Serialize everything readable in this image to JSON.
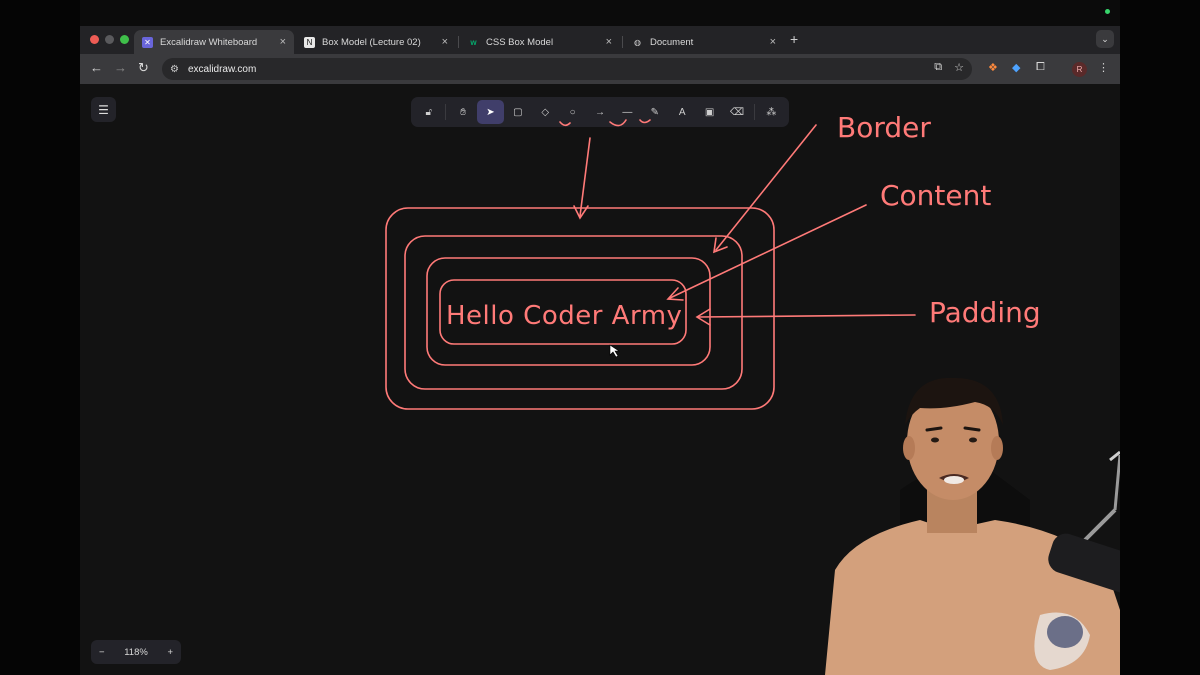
{
  "browser": {
    "tabs": [
      {
        "label": "Excalidraw Whiteboard",
        "active": true,
        "icon": "excalidraw-icon"
      },
      {
        "label": "Box Model (Lecture 02)",
        "active": false,
        "icon": "notion-icon"
      },
      {
        "label": "CSS Box Model",
        "active": false,
        "icon": "w3schools-icon"
      },
      {
        "label": "Document",
        "active": false,
        "icon": "globe-icon"
      }
    ],
    "url": "excalidraw.com",
    "profile_initial": "R"
  },
  "excalidraw": {
    "tools": [
      "lock",
      "hand",
      "selection",
      "rectangle",
      "diamond",
      "ellipse",
      "arrow",
      "line",
      "draw",
      "text",
      "image",
      "eraser",
      "more-tools"
    ],
    "active_tool": "selection",
    "zoom": "118%",
    "zoom_out": "−",
    "zoom_in": "+"
  },
  "drawing": {
    "inner_text": "Hello Coder Army",
    "labels": {
      "border": "Border",
      "content": "Content",
      "padding": "Padding"
    },
    "stroke_color": "#ff7a78"
  },
  "colors": {
    "canvas_bg": "#121212",
    "toolbar_bg": "#232329",
    "active_tool_bg": "#403e6a",
    "accent": "#ff7a78"
  }
}
